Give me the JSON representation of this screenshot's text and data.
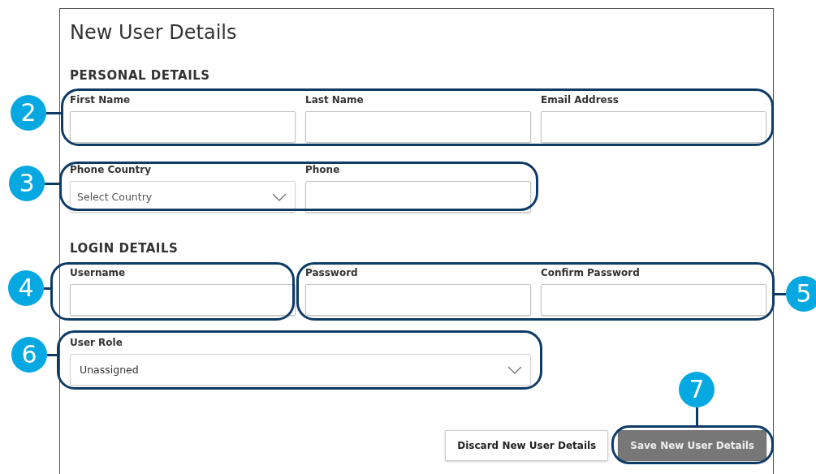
{
  "title": "New User Details",
  "sections": [
    {
      "heading": "PERSONAL DETAILS",
      "rows": [
        [
          {
            "label": "First Name",
            "kind": "text"
          },
          {
            "label": "Last Name",
            "kind": "text"
          },
          {
            "label": "Email Address",
            "kind": "text"
          }
        ],
        [
          {
            "label": "Phone Country",
            "kind": "select",
            "value": "Select Country"
          },
          {
            "label": "Phone",
            "kind": "text"
          }
        ]
      ]
    },
    {
      "heading": "LOGIN DETAILS",
      "rows": [
        [
          {
            "label": "Username",
            "kind": "text"
          },
          {
            "label": "Password",
            "kind": "text"
          },
          {
            "label": "Confirm Password",
            "kind": "text"
          }
        ],
        [
          {
            "label": "User Role",
            "kind": "wide-select",
            "value": "Unassigned"
          }
        ]
      ]
    }
  ],
  "buttons": [
    {
      "label": "Discard New User Details",
      "kind": "secondary",
      "disabled": false
    },
    {
      "label": "Save New User Details",
      "kind": "primary",
      "disabled": true
    }
  ],
  "callouts": [
    {
      "number": "2"
    },
    {
      "number": "3"
    },
    {
      "number": "4"
    },
    {
      "number": "5"
    },
    {
      "number": "6"
    },
    {
      "number": "7"
    }
  ]
}
